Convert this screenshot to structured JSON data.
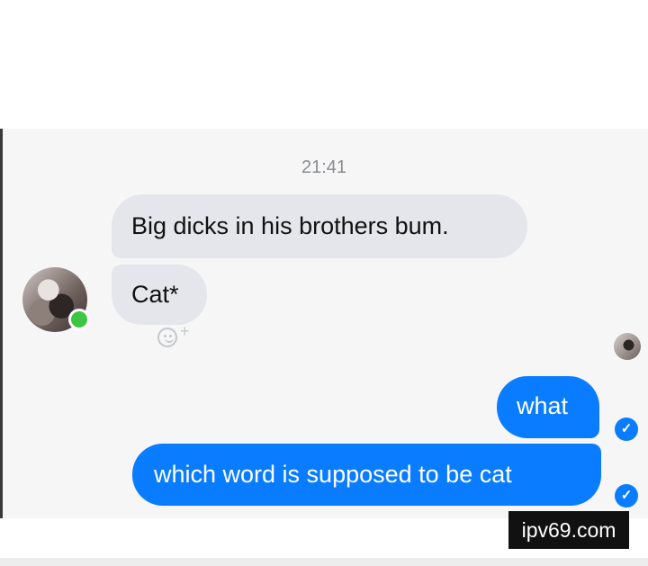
{
  "timestamp": "21:41",
  "incoming_messages": [
    {
      "text": "Big dicks in his brothers bum."
    },
    {
      "text": "Cat*"
    }
  ],
  "reaction_button": {
    "icon": "smile-plus-icon"
  },
  "outgoing_messages": [
    {
      "text": "what"
    },
    {
      "text": "which word is supposed to be cat"
    }
  ],
  "watermark": "ipv69.com",
  "colors": {
    "outgoing_bubble": "#0a7cff",
    "incoming_bubble": "#e4e6eb",
    "online_indicator": "#3cc742"
  }
}
